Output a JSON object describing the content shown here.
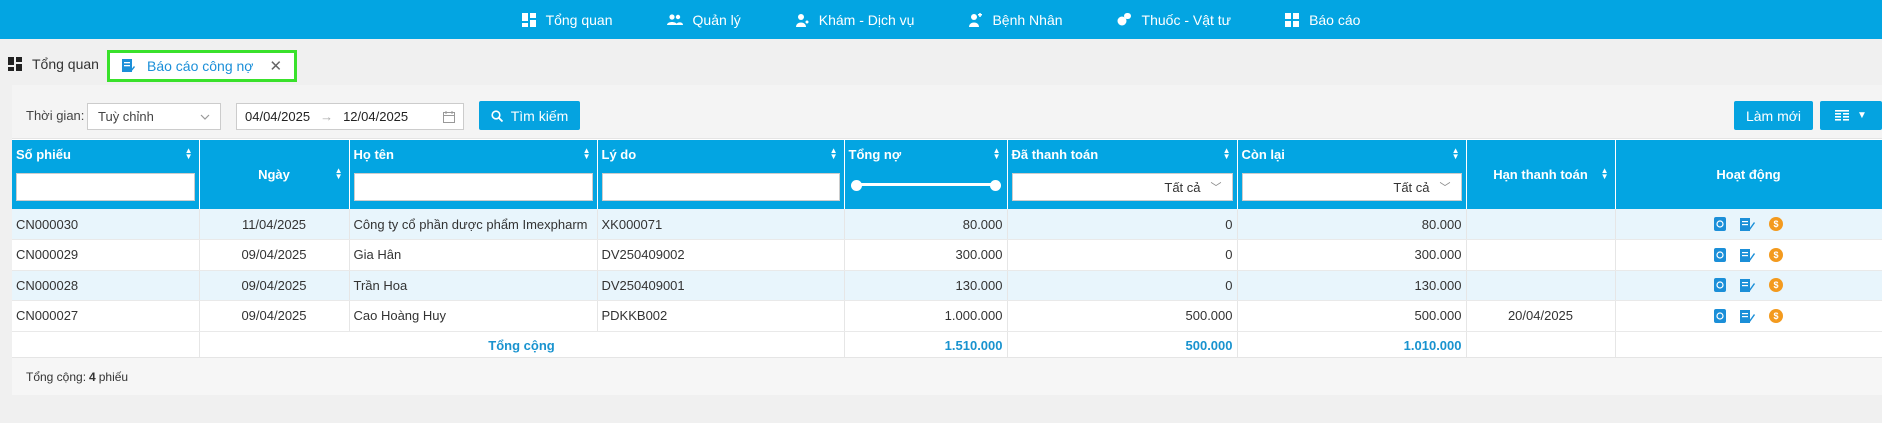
{
  "nav": [
    {
      "label": "Tổng quan",
      "icon": "dashboard-icon"
    },
    {
      "label": "Quản lý",
      "icon": "users-icon"
    },
    {
      "label": "Khám - Dịch vụ",
      "icon": "doctor-icon"
    },
    {
      "label": "Bệnh Nhân",
      "icon": "patient-icon"
    },
    {
      "label": "Thuốc - Vật tư",
      "icon": "pills-icon"
    },
    {
      "label": "Báo cáo",
      "icon": "report-icon"
    }
  ],
  "tabs": {
    "home": "Tổng quan",
    "active": "Báo cáo công nợ",
    "close": "✕"
  },
  "toolbar": {
    "time_label": "Thời gian:",
    "period": "Tuỳ chỉnh",
    "date_from": "04/04/2025",
    "date_arrow": "→",
    "date_to": "12/04/2025",
    "search_label": "Tìm kiếm",
    "refresh_label": "Làm mới"
  },
  "table": {
    "columns": [
      "Số phiếu",
      "Ngày",
      "Họ tên",
      "Lý do",
      "Tổng nợ",
      "Đã thanh toán",
      "Còn lại",
      "Hạn thanh toán",
      "Hoạt động"
    ],
    "filters": {
      "paid": "Tất cả",
      "remaining": "Tất cả"
    },
    "rows": [
      {
        "code": "CN000030",
        "date": "11/04/2025",
        "name": "Công ty cổ phần dược phẩm Imexpharm",
        "reason": "XK000071",
        "total": "80.000",
        "paid": "0",
        "remaining": "80.000",
        "due": ""
      },
      {
        "code": "CN000029",
        "date": "09/04/2025",
        "name": "Gia Hân",
        "reason": "DV250409002",
        "total": "300.000",
        "paid": "0",
        "remaining": "300.000",
        "due": ""
      },
      {
        "code": "CN000028",
        "date": "09/04/2025",
        "name": "Trần Hoa",
        "reason": "DV250409001",
        "total": "130.000",
        "paid": "0",
        "remaining": "130.000",
        "due": ""
      },
      {
        "code": "CN000027",
        "date": "09/04/2025",
        "name": "Cao Hoàng Huy",
        "reason": "PDKKB002",
        "total": "1.000.000",
        "paid": "500.000",
        "remaining": "500.000",
        "due": "20/04/2025"
      }
    ],
    "totals": {
      "label": "Tổng cộng",
      "total": "1.510.000",
      "paid": "500.000",
      "remaining": "1.010.000"
    }
  },
  "footer": {
    "prefix": "Tổng cộng:",
    "count": "4",
    "suffix": "phiếu"
  },
  "colors": {
    "primary": "#03a5e2",
    "row_alt": "#e8f5fc",
    "total_text": "#1993cf",
    "tab_highlight": "#39e12b",
    "coin": "#f39a1e"
  }
}
